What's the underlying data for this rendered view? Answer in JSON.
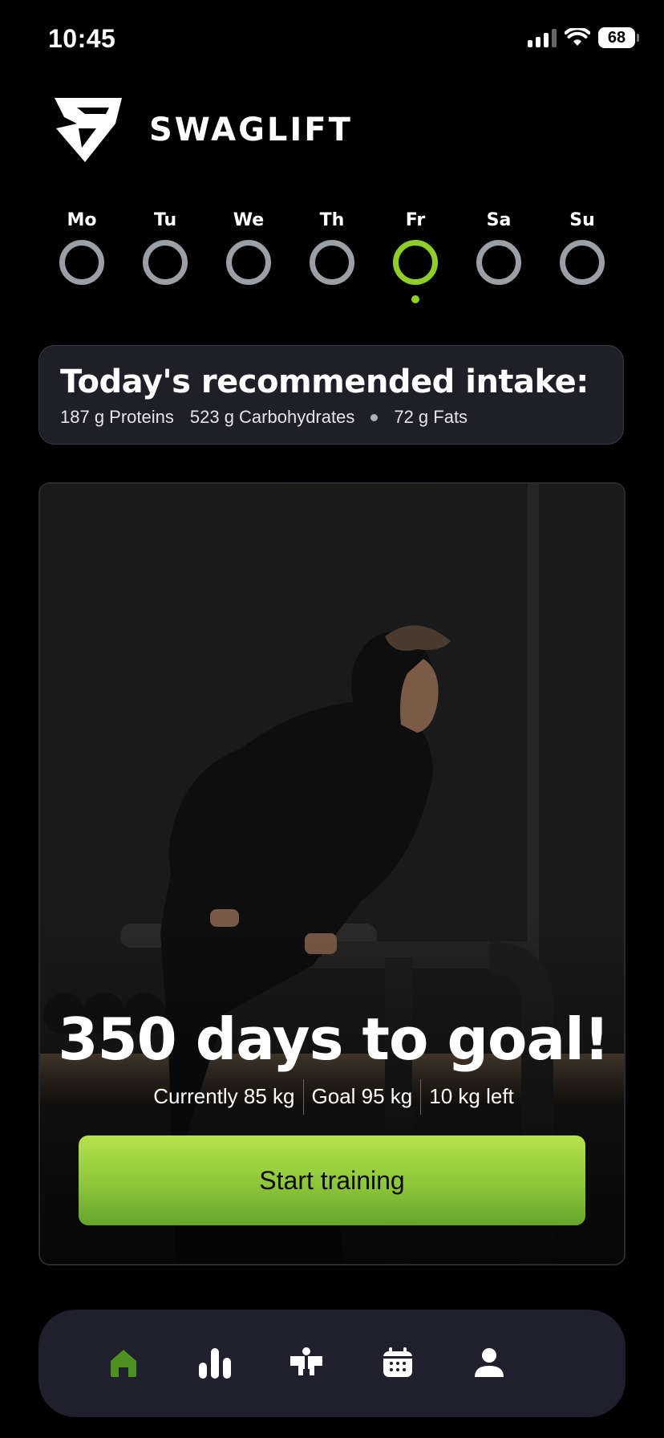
{
  "status_bar": {
    "time": "10:45",
    "battery": "68",
    "icons": [
      "cellular-signal-icon",
      "wifi-icon",
      "battery-icon"
    ]
  },
  "brand": {
    "name": "SWAGLIFT",
    "logo_icon": "swaglift-shield-logo"
  },
  "week": {
    "days": [
      "Mo",
      "Tu",
      "We",
      "Th",
      "Fr",
      "Sa",
      "Su"
    ],
    "active_day": "Fr",
    "ring_color": "#9aa0a6",
    "active_color": "#8fcd2a"
  },
  "intake": {
    "title": "Today's recommended intake:",
    "proteins": "187 g Proteins",
    "carbs": "523 g Carbohydrates",
    "fats": "72 g Fats"
  },
  "hero": {
    "title": "350 days to goal!",
    "current": "Currently 85 kg",
    "goal": "Goal 95 kg",
    "left": "10 kg left",
    "button_label": "Start training",
    "image_subject": "athlete-doing-dips-on-parallel-bars"
  },
  "tabbar": {
    "items": [
      "home-icon",
      "stats-icon",
      "workout-icon",
      "calendar-icon",
      "profile-icon"
    ],
    "active": "home-icon",
    "active_color": "#4e8f21"
  }
}
